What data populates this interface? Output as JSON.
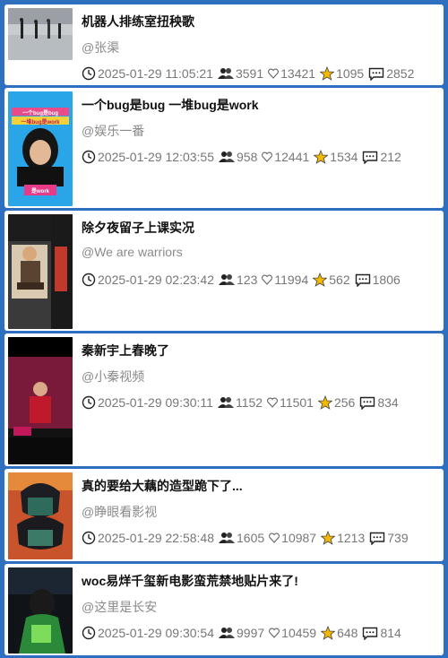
{
  "cards": [
    {
      "title": "机器人排练室扭秧歌",
      "author": "@张渠",
      "time": "2025-01-29 11:05:21",
      "users": "3591",
      "likes": "13421",
      "stars": "1095",
      "comments": "2852"
    },
    {
      "title": "一个bug是bug 一堆bug是work",
      "author": "@娱乐一番",
      "time": "2025-01-29 12:03:55",
      "users": "958",
      "likes": "12441",
      "stars": "1534",
      "comments": "212",
      "thumb_text": {
        "top": "一个bug是bug",
        "mid": "一堆bug是work",
        "badge": "是work"
      }
    },
    {
      "title": "除夕夜留子上课实况",
      "author": "@We are warriors",
      "time": "2025-01-29 02:23:42",
      "users": "123",
      "likes": "11994",
      "stars": "562",
      "comments": "1806"
    },
    {
      "title": "秦新宇上春晚了",
      "author": "@小秦视频",
      "time": "2025-01-29 09:30:11",
      "users": "1152",
      "likes": "11501",
      "stars": "256",
      "comments": "834"
    },
    {
      "title": "真的要给大藕的造型跪下了...",
      "author": "@睁眼看影视",
      "time": "2025-01-29 22:58:48",
      "users": "1605",
      "likes": "10987",
      "stars": "1213",
      "comments": "739"
    },
    {
      "title": "woc易烊千玺新电影蛮荒禁地贴片来了!",
      "author": "@这里是长安",
      "time": "2025-01-29 09:30:54",
      "users": "9997",
      "likes": "10459",
      "stars": "648",
      "comments": "814"
    }
  ],
  "colors": {
    "frame": "#2e6fbf",
    "star": "#f5b700",
    "muted": "#777777"
  },
  "icons": [
    "clock-icon",
    "users-icon",
    "heart-icon",
    "star-icon",
    "comment-icon"
  ]
}
